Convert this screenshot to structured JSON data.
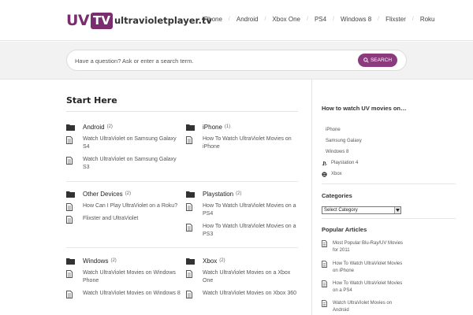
{
  "header": {
    "logo": {
      "uv": "UV",
      "tv": "TV",
      "domain": "ultravioletplayer.tv"
    },
    "nav": [
      "iPhone",
      "Android",
      "Xbox One",
      "PS4",
      "Windows 8",
      "Flixster",
      "Roku"
    ],
    "nav_separator": "/"
  },
  "search": {
    "placeholder": "Have a question? Ask or enter a search term.",
    "button_label": "SEARCH"
  },
  "main": {
    "title": "Start Here",
    "categories": [
      {
        "name": "Android",
        "count": "(2)",
        "articles": [
          "Watch UltraViolet on Samsung Galaxy S4",
          "Watch UltraViolet on Samsung Galaxy S3"
        ]
      },
      {
        "name": "iPhone",
        "count": "(1)",
        "articles": [
          "How To Watch UltraViolet Movies on iPhone"
        ]
      },
      {
        "name": "Other Devices",
        "count": "(2)",
        "articles": [
          "How Can I Play UltraViolet on a Roku?",
          "Flixster and UltraViolet"
        ]
      },
      {
        "name": "Playstation",
        "count": "(2)",
        "articles": [
          "How To Watch UltraViolet Movies on a PS4",
          "How To Watch UltraViolet Movies on a PS3"
        ]
      },
      {
        "name": "Windows",
        "count": "(2)",
        "articles": [
          "Watch UltraViolet Movies on Windows Phone",
          "Watch UltraViolet Movies on Windows 8"
        ]
      },
      {
        "name": "Xbox",
        "count": "(2)",
        "articles": [
          "Watch UltraViolet Movies on a Xbox One",
          "Watch UltraViolet Movies on Xbox 360"
        ]
      }
    ]
  },
  "sidebar": {
    "howto_title": "How to watch UV movies on…",
    "howto_items": [
      {
        "label": "iPhone",
        "icon": ""
      },
      {
        "label": "Samsung Galaxy",
        "icon": ""
      },
      {
        "label": "Windows 8",
        "icon": ""
      },
      {
        "label": "Playstation 4",
        "icon": "playstation-icon"
      },
      {
        "label": "Xbox",
        "icon": "xbox-icon"
      }
    ],
    "categories_title": "Categories",
    "categories_select": "Select Category",
    "popular_title": "Popular Articles",
    "popular": [
      "Most Popular Blu-Ray/UV Movies for 2011",
      "How To Watch UltraViolet Movies on iPhone",
      "How To Watch UltraViolet Movies on a PS4",
      "Watch UltraViolet Movies on Android"
    ]
  },
  "colors": {
    "brand": "#7a2e6f",
    "button": "#8b3a7e",
    "band": "#f2f2f2"
  }
}
